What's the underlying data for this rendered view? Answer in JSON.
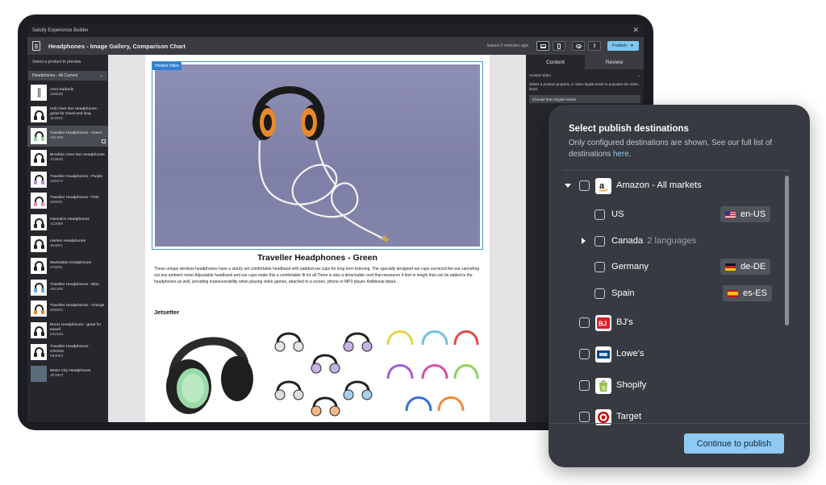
{
  "app": {
    "name": "Salsify Experience Builder",
    "doc_title": "Headphones - Image Gallery, Comparison Chart",
    "saved": "Saved 2 minutes ago",
    "publish": "Publish"
  },
  "sidebar": {
    "label": "Select a product to preview",
    "filter": "Headphones - All Current",
    "products": [
      {
        "name": "Aero Earbuds",
        "sku": "106545"
      },
      {
        "name": "Hub Over Ear Headphones - great for travel and long",
        "sku": "112616"
      },
      {
        "name": "Traveller Headphones - Green",
        "sku": "161409"
      },
      {
        "name": "Brooklyn Over Ear Headphones",
        "sku": "213833"
      },
      {
        "name": "Traveller Headphones - Purple",
        "sku": "328473"
      },
      {
        "name": "Traveller Headphones - Pink",
        "sku": "405051"
      },
      {
        "name": "Hannah's Headphones",
        "sku": "412898"
      },
      {
        "name": "Harlem Headphones",
        "sku": "454921"
      },
      {
        "name": "Manhattan Headphones",
        "sku": "475001"
      },
      {
        "name": "Traveller Headphones - Blue",
        "sku": "481336"
      },
      {
        "name": "Traveller Headphones - Orange",
        "sku": "608284"
      },
      {
        "name": "Bronx Headphones - great for travell",
        "sku": "631528"
      },
      {
        "name": "Traveller Headphones - Chrome",
        "sku": "694004"
      },
      {
        "name": "Motor City Headphones",
        "sku": "JET827"
      }
    ]
  },
  "canvas": {
    "video_tag": "Hosted Video",
    "product_title": "Traveller Headphones - Green",
    "description": "These unique wireless headphones have a sturdy yet comfortable headband with padded ear cups for long term listening. The specially designed ear cups surround the ear cancelling out any ambient noise.Adjustable headband and ear cups make this a comfortable fit for all.There is also a detachable cord that measures 4 feet in length that can be added to the headphones as well, providing maneuverability when playing video games, attached to a screen, phone or MP3 player. Additional detail...",
    "section_title": "Jetsetter"
  },
  "right_panel": {
    "tabs": [
      "Content",
      "Review"
    ],
    "block_label": "Hosted Video",
    "help": "Select a product property or video digital asset to populate the video block.",
    "select": "Choose from Digital Assets"
  },
  "modal": {
    "title": "Select publish destinations",
    "subtitle": "Only configured destinations are shown, See our full list of destinations",
    "link": "here.",
    "cta": "Continue to publish",
    "destinations": [
      {
        "label": "Amazon - All markets",
        "logo": "amazon-logo"
      },
      {
        "label": "US",
        "locale": "en-US",
        "flag": "us-flag"
      },
      {
        "label": "Canada",
        "note": "2 languages"
      },
      {
        "label": "Germany",
        "locale": "de-DE",
        "flag": "de-flag"
      },
      {
        "label": "Spain",
        "locale": "es-ES",
        "flag": "es-flag"
      },
      {
        "label": "BJ's",
        "logo": "bjs-logo"
      },
      {
        "label": "Lowe's",
        "logo": "lowes-logo"
      },
      {
        "label": "Shopify",
        "logo": "shopify-logo"
      },
      {
        "label": "Target",
        "logo": "target-logo"
      }
    ]
  },
  "colors": {
    "accent": "#8fcaf4",
    "modal_bg": "#373b41",
    "device_bg": "#1c1d20",
    "selection": "#2f7fd0"
  }
}
